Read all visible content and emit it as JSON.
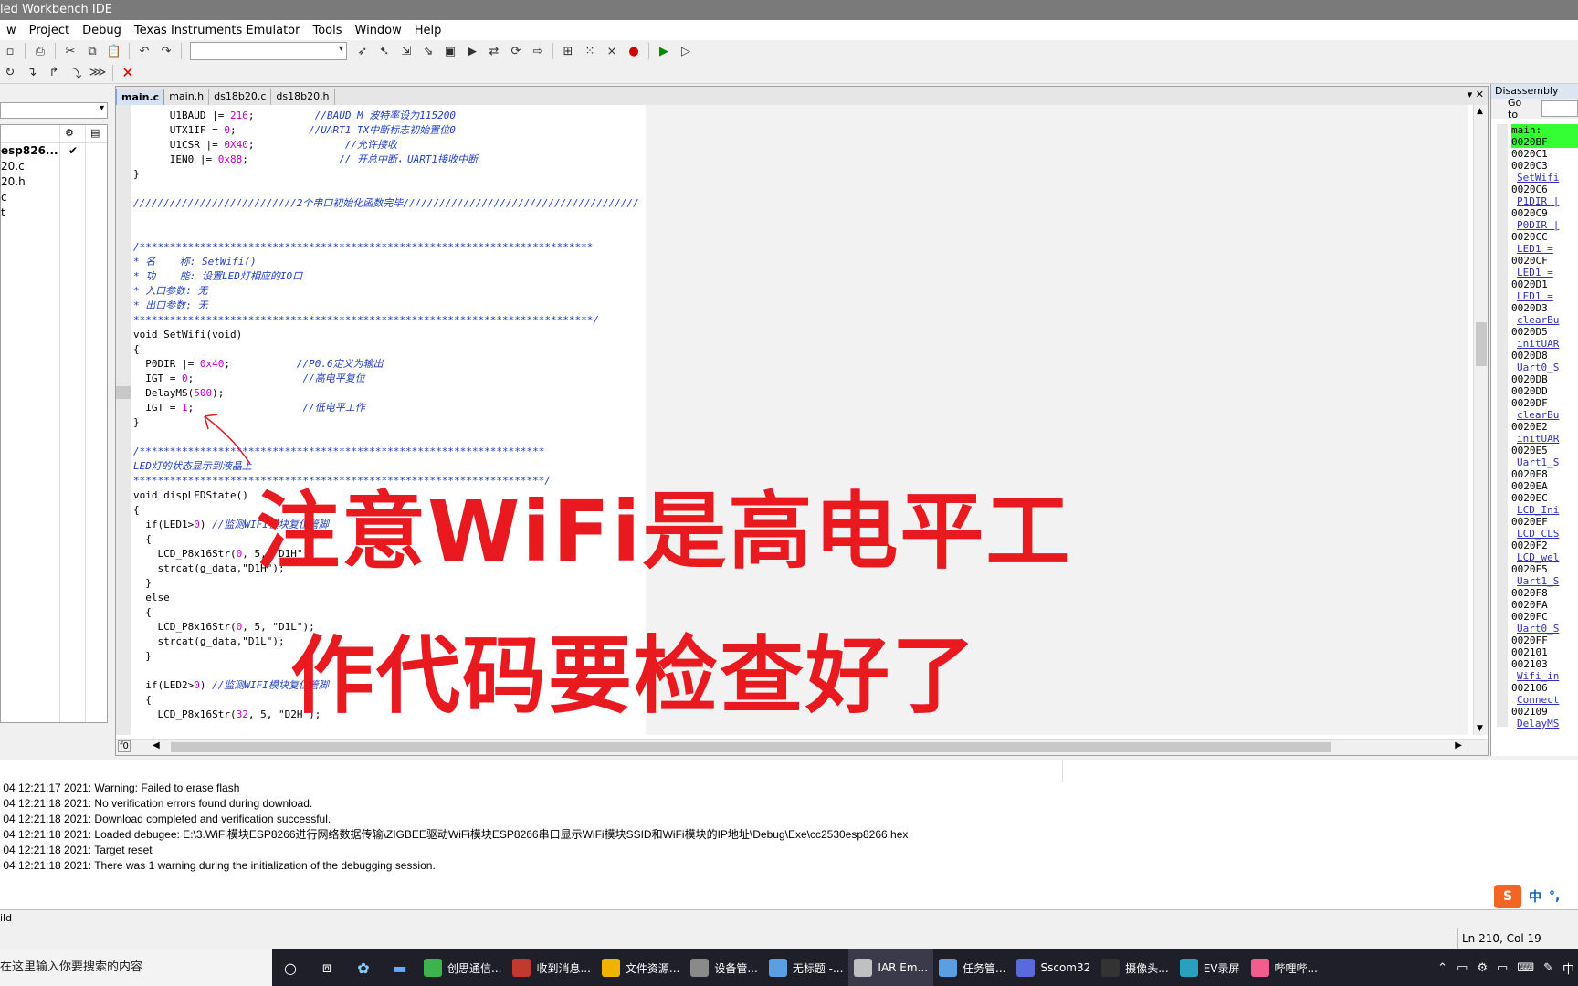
{
  "window": {
    "title": "led Workbench IDE"
  },
  "menu": [
    "w",
    "Project",
    "Debug",
    "Texas Instruments Emulator",
    "Tools",
    "Window",
    "Help"
  ],
  "workspace": {
    "files": [
      "esp826...",
      "20.c",
      "20.h",
      "c",
      "t"
    ],
    "check": "✔"
  },
  "editor": {
    "tabs": [
      "main.c",
      "main.h",
      "ds18b20.c",
      "ds18b20.h"
    ],
    "active_tab": "main.c"
  },
  "code_lines": [
    {
      "pre": "      U1BAUD |= ",
      "num": "216",
      "post": ";          ",
      "cm": "//BAUD_M 波特率设为115200"
    },
    {
      "pre": "      UTX1IF = ",
      "num": "0",
      "post": ";            ",
      "cm": "//UART1 TX中断标志初始置位0"
    },
    {
      "pre": "      U1CSR |= ",
      "num": "0X40",
      "post": ";               ",
      "cm": "//允许接收"
    },
    {
      "pre": "      IEN0 |= ",
      "num": "0x88",
      "post": ";               ",
      "cm": "// 开总中断，UART1接收中断"
    },
    {
      "pre": "}",
      "num": "",
      "post": "",
      "cm": ""
    },
    {
      "pre": "",
      "num": "",
      "post": "",
      "cm": ""
    },
    {
      "pre": "",
      "num": "",
      "post": "",
      "cm": "///////////////////////////2个串口初始化函数完毕///////////////////////////////////////"
    },
    {
      "pre": "",
      "num": "",
      "post": "",
      "cm": ""
    },
    {
      "pre": "",
      "num": "",
      "post": "",
      "cm": ""
    },
    {
      "pre": "",
      "num": "",
      "post": "",
      "cm": "/***************************************************************************"
    },
    {
      "pre": "",
      "num": "",
      "post": "",
      "cm": "* 名    称: SetWifi()"
    },
    {
      "pre": "",
      "num": "",
      "post": "",
      "cm": "* 功    能: 设置LED灯相应的IO口"
    },
    {
      "pre": "",
      "num": "",
      "post": "",
      "cm": "* 入口参数: 无"
    },
    {
      "pre": "",
      "num": "",
      "post": "",
      "cm": "* 出口参数: 无"
    },
    {
      "pre": "",
      "num": "",
      "post": "",
      "cm": "****************************************************************************/"
    },
    {
      "pre": "void SetWifi(void)",
      "num": "",
      "post": "",
      "cm": ""
    },
    {
      "pre": "{",
      "num": "",
      "post": "",
      "cm": ""
    },
    {
      "pre": "  P0DIR |= ",
      "num": "0x40",
      "post": ";           ",
      "cm": "//P0.6定义为输出"
    },
    {
      "pre": "  IGT = ",
      "num": "0",
      "post": ";                  ",
      "cm": "//高电平复位"
    },
    {
      "pre": "  DelayMS(",
      "num": "500",
      "post": ");",
      "cm": ""
    },
    {
      "pre": "  IGT = ",
      "num": "1",
      "post": ";                  ",
      "cm": "//低电平工作"
    },
    {
      "pre": "}",
      "num": "",
      "post": "",
      "cm": ""
    },
    {
      "pre": "",
      "num": "",
      "post": "",
      "cm": ""
    },
    {
      "pre": "",
      "num": "",
      "post": "",
      "cm": "/*******************************************************************"
    },
    {
      "pre": "",
      "num": "",
      "post": "",
      "cm": "LED灯的状态显示到液晶上"
    },
    {
      "pre": "",
      "num": "",
      "post": "",
      "cm": "********************************************************************/"
    },
    {
      "pre": "void dispLEDState()",
      "num": "",
      "post": "",
      "cm": ""
    },
    {
      "pre": "{",
      "num": "",
      "post": "",
      "cm": ""
    },
    {
      "pre": "  if(LED1>",
      "num": "0",
      "post": ") ",
      "cm": "//监测WIFI模块复位管脚"
    },
    {
      "pre": "  {",
      "num": "",
      "post": "",
      "cm": ""
    },
    {
      "pre": "    LCD_P8x16Str(",
      "num": "0",
      "post": ", 5, \"D1H\");",
      "cm": ""
    },
    {
      "pre": "    strcat(g_data,\"D1H\");",
      "num": "",
      "post": "",
      "cm": ""
    },
    {
      "pre": "  }",
      "num": "",
      "post": "",
      "cm": ""
    },
    {
      "pre": "  else",
      "num": "",
      "post": "",
      "cm": ""
    },
    {
      "pre": "  {",
      "num": "",
      "post": "",
      "cm": ""
    },
    {
      "pre": "    LCD_P8x16Str(",
      "num": "0",
      "post": ", 5, \"D1L\");",
      "cm": ""
    },
    {
      "pre": "    strcat(g_data,\"D1L\");",
      "num": "",
      "post": "",
      "cm": ""
    },
    {
      "pre": "  }",
      "num": "",
      "post": "",
      "cm": ""
    },
    {
      "pre": "",
      "num": "",
      "post": "",
      "cm": ""
    },
    {
      "pre": "  if(LED2>",
      "num": "0",
      "post": ") ",
      "cm": "//监测WIFI模块复位管脚"
    },
    {
      "pre": "  {",
      "num": "",
      "post": "",
      "cm": ""
    },
    {
      "pre": "    LCD_P8x16Str(",
      "num": "32",
      "post": ", 5, \"D2H\");",
      "cm": ""
    }
  ],
  "gutter_label": "f0",
  "disassembly": {
    "title": "Disassembly",
    "goto_label": "Go to",
    "lines": [
      {
        "t": "main:",
        "k": "hl"
      },
      {
        "t": "0020BF",
        "k": "hl"
      },
      {
        "t": "0020C1",
        "k": ""
      },
      {
        "t": "0020C3",
        "k": ""
      },
      {
        "t": "SetWifi",
        "k": "src"
      },
      {
        "t": "0020C6",
        "k": ""
      },
      {
        "t": "P1DIR |",
        "k": "src"
      },
      {
        "t": "0020C9",
        "k": ""
      },
      {
        "t": "P0DIR |",
        "k": "src"
      },
      {
        "t": "0020CC",
        "k": ""
      },
      {
        "t": "LED1 =",
        "k": "src"
      },
      {
        "t": "0020CF",
        "k": ""
      },
      {
        "t": "LED1 =",
        "k": "src"
      },
      {
        "t": "0020D1",
        "k": ""
      },
      {
        "t": "LED1 =",
        "k": "src"
      },
      {
        "t": "0020D3",
        "k": ""
      },
      {
        "t": "clearBu",
        "k": "src"
      },
      {
        "t": "0020D5",
        "k": ""
      },
      {
        "t": "initUAR",
        "k": "src"
      },
      {
        "t": "0020D8",
        "k": ""
      },
      {
        "t": "Uart0_S",
        "k": "src"
      },
      {
        "t": "0020DB",
        "k": ""
      },
      {
        "t": "0020DD",
        "k": ""
      },
      {
        "t": "0020DF",
        "k": ""
      },
      {
        "t": "clearBu",
        "k": "src"
      },
      {
        "t": "0020E2",
        "k": ""
      },
      {
        "t": "initUAR",
        "k": "src"
      },
      {
        "t": "0020E5",
        "k": ""
      },
      {
        "t": "Uart1_S",
        "k": "src"
      },
      {
        "t": "0020E8",
        "k": ""
      },
      {
        "t": "0020EA",
        "k": ""
      },
      {
        "t": "0020EC",
        "k": ""
      },
      {
        "t": "LCD_Ini",
        "k": "src"
      },
      {
        "t": "0020EF",
        "k": ""
      },
      {
        "t": "LCD_CLS",
        "k": "src"
      },
      {
        "t": "0020F2",
        "k": ""
      },
      {
        "t": "LCD_wel",
        "k": "src"
      },
      {
        "t": "0020F5",
        "k": ""
      },
      {
        "t": "Uart1_S",
        "k": "src"
      },
      {
        "t": "0020F8",
        "k": ""
      },
      {
        "t": "0020FA",
        "k": ""
      },
      {
        "t": "0020FC",
        "k": ""
      },
      {
        "t": "Uart0_S",
        "k": "src"
      },
      {
        "t": "0020FF",
        "k": ""
      },
      {
        "t": "002101",
        "k": ""
      },
      {
        "t": "002103",
        "k": ""
      },
      {
        "t": "Wifi_in",
        "k": "src"
      },
      {
        "t": "002106",
        "k": ""
      },
      {
        "t": "Connect",
        "k": "src"
      },
      {
        "t": "002109",
        "k": ""
      },
      {
        "t": "DelayMS",
        "k": "src"
      }
    ]
  },
  "messages": [
    " 04 12:21:17 2021: Warning: Failed to erase flash",
    " 04 12:21:18 2021: No verification errors found during download.",
    " 04 12:21:18 2021: Download completed and verification successful.",
    " 04 12:21:18 2021: Loaded debugee: E:\\3.WiFi模块ESP8266进行网络数据传输\\ZIGBEE驱动WiFi模块ESP8266串口显示WiFi模块SSID和WiFi模块的IP地址\\Debug\\Exe\\cc2530esp8266.hex",
    " 04 12:21:18 2021: Target reset",
    " 04 12:21:18 2021: There was 1 warning during the initialization of the debugging session."
  ],
  "ime": {
    "logo": "S",
    "lang": "中",
    "punct": "°,"
  },
  "build_tab": "ild",
  "status": {
    "position": "Ln 210, Col 19"
  },
  "annotation": {
    "line1": "注意WiFi是高电平工",
    "line2": "作代码要检查好了",
    "color": "#e8191f"
  },
  "taskbar": {
    "search": "在这里输入你要搜索的内容",
    "items": [
      {
        "label": "创思通信...",
        "color": "#3cb44b"
      },
      {
        "label": "收到消息...",
        "color": "#c0392b"
      },
      {
        "label": "文件资源...",
        "color": "#f0b400"
      },
      {
        "label": "设备管...",
        "color": "#8a8a8a"
      },
      {
        "label": "无标题 -...",
        "color": "#5aa0e0"
      },
      {
        "label": "IAR Em...",
        "color": "#c0c0c0"
      },
      {
        "label": "任务管...",
        "color": "#5aa0e0"
      },
      {
        "label": "Sscom32",
        "color": "#5a6adc"
      },
      {
        "label": "摄像头...",
        "color": "#333333"
      },
      {
        "label": "EV录屏",
        "color": "#2aa0c0"
      },
      {
        "label": "哔哩哔...",
        "color": "#f25d8e"
      }
    ],
    "tray_text": "中"
  }
}
